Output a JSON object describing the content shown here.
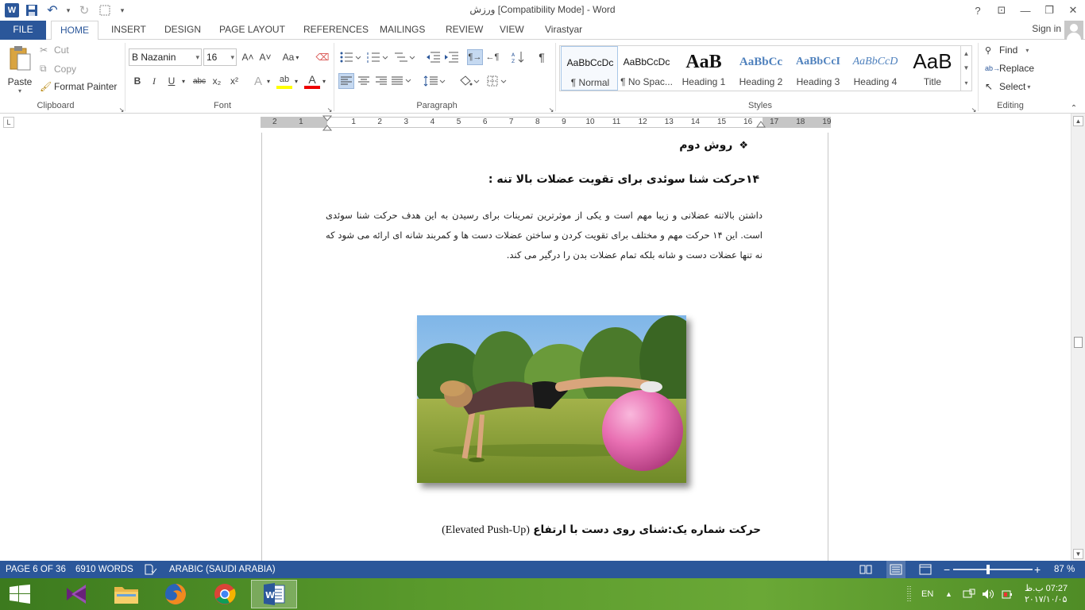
{
  "window": {
    "title": "ورزش [Compatibility Mode] - Word",
    "help": "?",
    "restore_ribbon": "⊡",
    "minimize": "—",
    "maximize": "❐",
    "close": "✕"
  },
  "qat": {
    "undo": "↶",
    "redo": "↻",
    "more": "▾"
  },
  "tabs": [
    "FILE",
    "HOME",
    "INSERT",
    "DESIGN",
    "PAGE LAYOUT",
    "REFERENCES",
    "MAILINGS",
    "REVIEW",
    "VIEW",
    "Virastyar"
  ],
  "account": {
    "signin": "Sign in"
  },
  "clipboard": {
    "label": "Clipboard",
    "paste": "Paste",
    "cut": "Cut",
    "copy": "Copy",
    "format_painter": "Format Painter"
  },
  "font": {
    "label": "Font",
    "family": "B Nazanin",
    "size": "16",
    "grow": "A˄",
    "shrink": "A˅",
    "case": "Aa",
    "bold": "B",
    "italic": "I",
    "underline": "U",
    "strike": "abc",
    "subscript": "x₂",
    "superscript": "x²",
    "effects": "A",
    "highlight": "ab",
    "color": "A"
  },
  "paragraph": {
    "label": "Paragraph",
    "pilcrow": "¶"
  },
  "styles": {
    "label": "Styles",
    "items": [
      {
        "sample": "AaBbCcDc",
        "name": "¶ Normal"
      },
      {
        "sample": "AaBbCcDc",
        "name": "¶ No Spac..."
      },
      {
        "sample": "AaB",
        "name": "Heading 1"
      },
      {
        "sample": "AaBbCc",
        "name": "Heading 2"
      },
      {
        "sample": "AaBbCcI",
        "name": "Heading 3"
      },
      {
        "sample": "AaBbCcD",
        "name": "Heading 4"
      },
      {
        "sample": "AaB",
        "name": "Title"
      }
    ]
  },
  "editing": {
    "label": "Editing",
    "find": "Find",
    "replace": "Replace",
    "select": "Select"
  },
  "ruler": {
    "corner": "L",
    "numbers": [
      "2",
      "1",
      "1",
      "2",
      "3",
      "4",
      "5",
      "6",
      "7",
      "8",
      "9",
      "10",
      "11",
      "12",
      "13",
      "14",
      "15",
      "16",
      "17",
      "18",
      "19"
    ]
  },
  "document": {
    "heading_dot": "روش دوم",
    "bullet": "❖",
    "subheading": "۱۴حرکت شنا سوئدی برای تقویت عضلات بالا تنه :",
    "paragraph": "داشتن بالاتنه عضلانی و زیبا مهم است و یکی از موثرترین تمرینات برای رسیدن به این هدف حرکت شنا سوئدی است. این  ۱۴ حرکت مهم و مختلف برای تقویت کردن و ساختن عضلات دست ها و کمربند شانه ای ارائه می شود که نه تنها عضلات دست و شانه بلکه تمام عضلات بدن را درگیر می کند.",
    "bottom_heading_fa": "حرکت شماره یک:شنای روی دست با ارتفاع",
    "bottom_heading_en": "(Elevated Push-Up)"
  },
  "status": {
    "page": "PAGE 6 OF 36",
    "words": "6910 WORDS",
    "language": "ARABIC (SAUDI ARABIA)",
    "zoom_minus": "−",
    "zoom_plus": "+",
    "zoom": "87 %"
  },
  "taskbar": {
    "lang": "EN",
    "time": "07:27 ب.ظ",
    "date": "۲۰۱۷/۱۰/۰۵"
  },
  "colors": {
    "accent": "#2b579a",
    "taskbar": "#5a9a2c"
  }
}
